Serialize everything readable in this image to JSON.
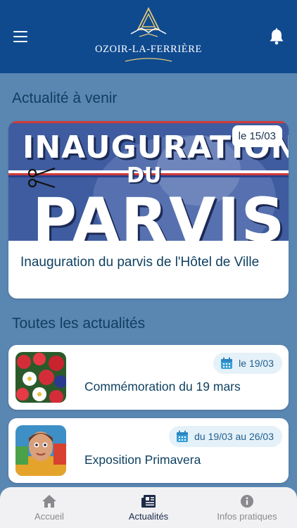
{
  "header": {
    "logo_text": "OZOIR-LA-FERRIÈRE",
    "menu_icon": "hamburger-menu-icon",
    "bell_icon": "bell-icon"
  },
  "upcoming": {
    "section_title": "Actualité à venir",
    "image_text_line1": "INAUGURATION",
    "image_text_line2": "DU",
    "image_text_line3": "PARVIS",
    "date_badge": "le 15/03",
    "title": "Inauguration du parvis de l'Hôtel de Ville"
  },
  "all_news": {
    "section_title": "Toutes les actualités",
    "items": [
      {
        "date": "le 19/03",
        "title": "Commémoration du 19 mars"
      },
      {
        "date": "du 19/03 au 26/03",
        "title": "Exposition Primavera"
      }
    ]
  },
  "tabbar": {
    "tabs": [
      {
        "label": "Accueil",
        "icon": "home-icon",
        "active": false
      },
      {
        "label": "Actualités",
        "icon": "newspaper-icon",
        "active": true
      },
      {
        "label": "Infos pratiques",
        "icon": "info-icon",
        "active": false
      }
    ]
  },
  "colors": {
    "header": "#0f4a8f",
    "background": "#5a86b2",
    "title_text": "#0d3f5f",
    "pill_bg": "#e5f1f8"
  }
}
